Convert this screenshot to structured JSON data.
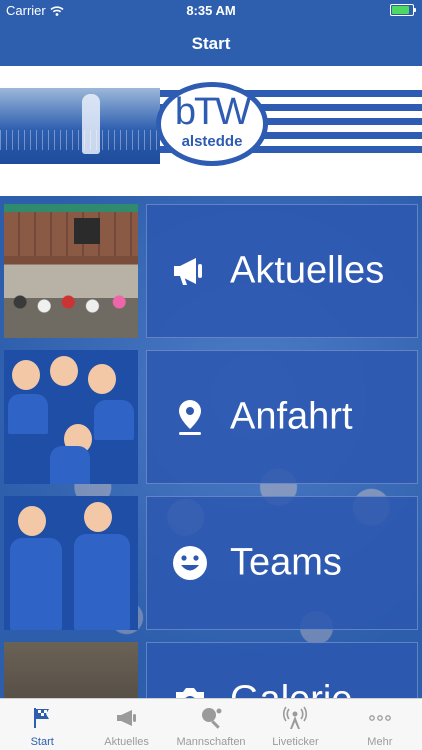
{
  "status_bar": {
    "carrier": "Carrier",
    "time": "8:35 AM",
    "battery_level": 0.9,
    "battery_color": "#4cd964"
  },
  "navbar": {
    "title": "Start"
  },
  "logo": {
    "main": "bTW",
    "sub": "alstedde"
  },
  "tiles": [
    {
      "label": "Aktuelles",
      "icon": "megaphone-icon"
    },
    {
      "label": "Anfahrt",
      "icon": "map-pin-icon"
    },
    {
      "label": "Teams",
      "icon": "smiley-icon"
    },
    {
      "label": "Galerie",
      "icon": "camera-icon"
    }
  ],
  "tabbar": {
    "items": [
      {
        "label": "Start",
        "icon": "flag-icon",
        "active": true
      },
      {
        "label": "Aktuelles",
        "icon": "megaphone-icon",
        "active": false
      },
      {
        "label": "Mannschaften",
        "icon": "tennis-racket-icon",
        "active": false
      },
      {
        "label": "Liveticker",
        "icon": "broadcast-icon",
        "active": false
      },
      {
        "label": "Mehr",
        "icon": "more-dots-icon",
        "active": false
      }
    ]
  },
  "colors": {
    "brand_blue": "#2d5fae",
    "tab_inactive": "#9b9b9b"
  }
}
